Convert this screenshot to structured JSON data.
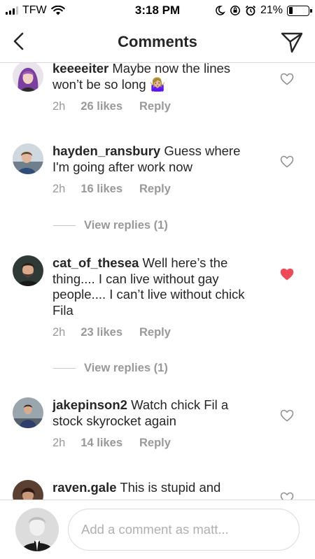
{
  "status_bar": {
    "carrier": "TFW",
    "time": "3:18 PM",
    "battery_percent": "21%",
    "battery_level": 0.21,
    "icons": [
      "signal-icon",
      "wifi-icon",
      "moon-icon",
      "orientation-lock-icon",
      "alarm-icon",
      "battery-icon"
    ]
  },
  "header": {
    "title": "Comments",
    "back_icon": "chevron-left-icon",
    "share_icon": "paper-plane-icon"
  },
  "comments": [
    {
      "username": "keeeeiter",
      "text": "Maybe now the lines won’t be so long 🤷🏼‍♀️",
      "time": "2h",
      "likes": "26 likes",
      "reply_label": "Reply",
      "liked": false
    },
    {
      "username": "hayden_ransbury",
      "text": "Guess where I'm going after work now",
      "time": "2h",
      "likes": "16 likes",
      "reply_label": "Reply",
      "liked": false,
      "view_replies": "View replies (1)"
    },
    {
      "username": "cat_of_thesea",
      "text": "Well here’s the thing.... I can live without gay people.... I can’t live without chick Fila",
      "time": "2h",
      "likes": "23 likes",
      "reply_label": "Reply",
      "liked": true,
      "view_replies": "View replies (1)"
    },
    {
      "username": "jakepinson2",
      "text": "Watch chick Fil a stock skyrocket again",
      "time": "2h",
      "likes": "14 likes",
      "reply_label": "Reply",
      "liked": false
    },
    {
      "username": "raven.gale",
      "text": "This is stupid and",
      "liked": false
    }
  ],
  "composer": {
    "placeholder": "Add a comment as matt..."
  },
  "colors": {
    "text": "#262626",
    "muted": "#999999",
    "divider": "#dbdbdb",
    "liked_heart": "#ed4956",
    "unliked_heart": "#8e8e8e"
  }
}
